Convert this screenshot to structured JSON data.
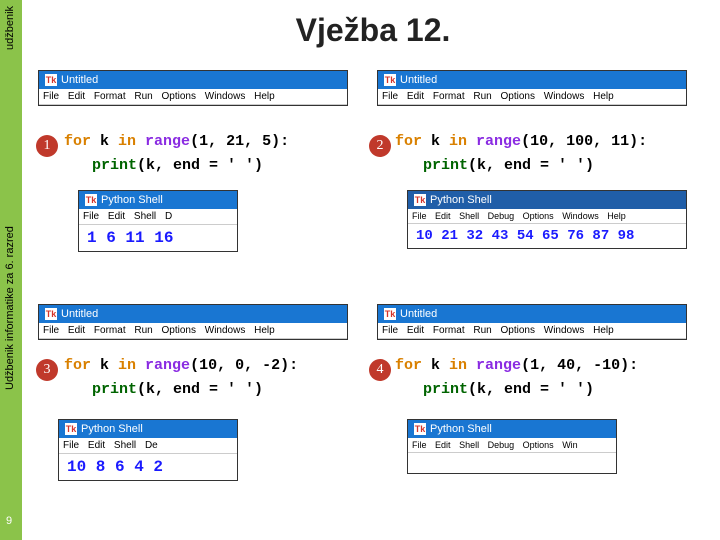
{
  "sidebar": {
    "text_bottom": "Udžbenik informatike za 6. razred",
    "text_top": "udžbenik",
    "page_num": "9"
  },
  "title": "Vježba 12.",
  "cells": [
    {
      "badge": "1",
      "code_line1_pre": "for ",
      "code_line1_var": "k ",
      "code_line1_in": "in ",
      "code_line1_fn": "range",
      "code_line1_args": "(1, 21, 5):",
      "code_line2_fn": "print",
      "code_line2_args": "(k, end = ' ')",
      "editor_title": "Untitled",
      "editor_menu": [
        "File",
        "Edit",
        "Format",
        "Run",
        "Options",
        "Windows",
        "Help"
      ],
      "shell_title": "Python Shell",
      "shell_menu": [
        "File",
        "Edit",
        "Shell",
        "D"
      ],
      "output": "1 6 11 16"
    },
    {
      "badge": "2",
      "code_line1_pre": "for ",
      "code_line1_var": "k ",
      "code_line1_in": "in ",
      "code_line1_fn": "range",
      "code_line1_args": "(10, 100, 11):",
      "code_line2_fn": "print",
      "code_line2_args": "(k, end = '  ')",
      "editor_title": "Untitled",
      "editor_menu": [
        "File",
        "Edit",
        "Format",
        "Run",
        "Options",
        "Windows",
        "Help"
      ],
      "shell_title": "Python Shell",
      "shell_menu": [
        "File",
        "Edit",
        "Shell",
        "Debug",
        "Options",
        "Windows",
        "Help"
      ],
      "output": "10 21 32 43 54 65 76 87 98"
    },
    {
      "badge": "3",
      "code_line1_pre": "for ",
      "code_line1_var": "k ",
      "code_line1_in": "in ",
      "code_line1_fn": "range",
      "code_line1_args": "(10, 0, -2):",
      "code_line2_fn": "print",
      "code_line2_args": "(k, end = ' ')",
      "editor_title": "Untitled",
      "editor_menu": [
        "File",
        "Edit",
        "Format",
        "Run",
        "Options",
        "Windows",
        "Help"
      ],
      "shell_title": "Python Shell",
      "shell_menu": [
        "File",
        "Edit",
        "Shell",
        "De"
      ],
      "output": "10 8 6 4 2"
    },
    {
      "badge": "4",
      "code_line1_pre": "for ",
      "code_line1_var": "k ",
      "code_line1_in": "in ",
      "code_line1_fn": "range",
      "code_line1_args": "(1, 40, -10):",
      "code_line2_fn": "print",
      "code_line2_args": "(k, end = '  ')",
      "editor_title": "Untitled",
      "editor_menu": [
        "File",
        "Edit",
        "Format",
        "Run",
        "Options",
        "Windows",
        "Help"
      ],
      "shell_title": "Python Shell",
      "shell_menu": [
        "File",
        "Edit",
        "Shell",
        "Debug",
        "Options",
        "Win"
      ],
      "output": ""
    }
  ],
  "icon_label": "Tk"
}
